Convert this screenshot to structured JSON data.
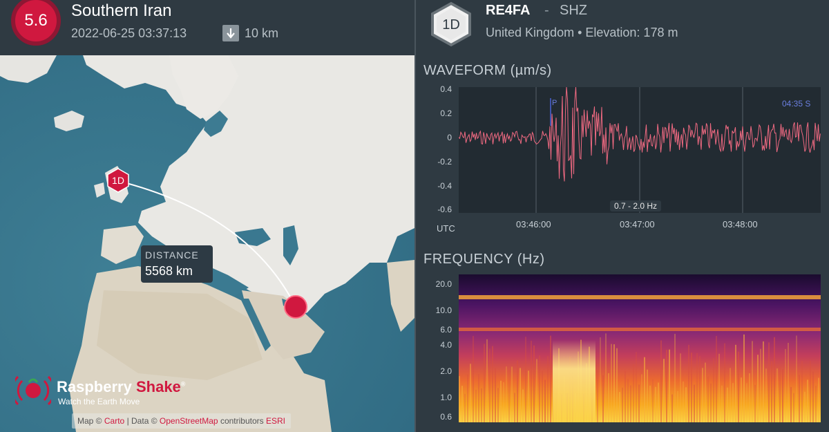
{
  "event": {
    "magnitude": "5.6",
    "region": "Southern Iran",
    "datetime": "2022-06-25 03:37:13",
    "depth": "10 km"
  },
  "map": {
    "distance_label": "DISTANCE",
    "distance_value": "5568 km",
    "station_marker": "1D",
    "attribution_prefix": "Map ©",
    "attribution_link1": "Carto",
    "attribution_mid": "| Data ©",
    "attribution_link2": "OpenStreetMap",
    "attribution_suffix": "contributors",
    "attribution_link3": "ESRI"
  },
  "brand": {
    "name_part1": "Raspberry",
    "name_part2": "Shake",
    "registered": "®",
    "tagline": "Watch the Earth Move"
  },
  "station": {
    "badge": "1D",
    "code": "RE4FA",
    "separator": "-",
    "channel": "SHZ",
    "location": "United Kingdom • Elevation: 178 m"
  },
  "waveform": {
    "title": "WAVEFORM (µm/s)",
    "yticks": [
      "0.4",
      "0.2",
      "0",
      "-0.2",
      "-0.4",
      "-0.6"
    ],
    "xticks": [
      "03:46:00",
      "03:47:00",
      "03:48:00"
    ],
    "timezone": "UTC",
    "phase_label": "P",
    "phase_end_label": "04:35 S",
    "filter": "0.7 - 2.0 Hz"
  },
  "frequency": {
    "title": "FREQUENCY (Hz)",
    "yticks": [
      "20.0",
      "10.0",
      "6.0",
      "4.0",
      "2.0",
      "1.0",
      "0.6"
    ]
  },
  "colors": {
    "accent": "#d0183f",
    "waveform": "#f16a82",
    "panel_bg": "#2f3a42",
    "plot_bg": "#222b32"
  }
}
